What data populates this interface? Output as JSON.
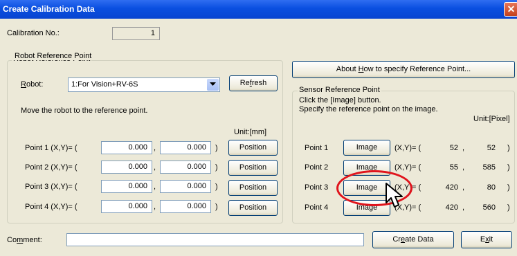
{
  "window": {
    "title": "Create Calibration Data",
    "close_glyph": "✕"
  },
  "calibration": {
    "label": "Calibration No.:",
    "value": "1"
  },
  "robot_ref": {
    "group_title": "Robot Reference Point",
    "robot_label_u": "R",
    "robot_label_rest": "obot:",
    "robot_value": "1:For Vision+RV-6S",
    "refresh_pre": "Re",
    "refresh_u": "f",
    "refresh_post": "resh",
    "instruction": "Move the robot to the reference point.",
    "unit": "Unit:[mm]",
    "points": [
      {
        "label": "Point 1 (X,Y)= (",
        "x": "0.000",
        "y": "0.000",
        "button": "Position"
      },
      {
        "label": "Point 2 (X,Y)= (",
        "x": "0.000",
        "y": "0.000",
        "button": "Position"
      },
      {
        "label": "Point 3 (X,Y)= (",
        "x": "0.000",
        "y": "0.000",
        "button": "Position"
      },
      {
        "label": "Point 4 (X,Y)= (",
        "x": "0.000",
        "y": "0.000",
        "button": "Position"
      }
    ],
    "comma": ",",
    "close_paren": ")"
  },
  "about_button": {
    "pre": "About ",
    "u": "H",
    "post": "ow to specify Reference Point..."
  },
  "sensor_ref": {
    "group_title": "Sensor Reference Point",
    "instruction1": "Click the [Image] button.",
    "instruction2": "Specify the reference point on the image.",
    "unit": "Unit:[Pixel]",
    "points": [
      {
        "label": "Point 1",
        "button": "Image",
        "coord_label": "(X,Y)= (",
        "x": "52",
        "y": "52"
      },
      {
        "label": "Point 2",
        "button": "Image",
        "coord_label": "(X,Y)= (",
        "x": "55",
        "y": "585"
      },
      {
        "label": "Point 3",
        "button": "Image",
        "coord_label": "(X,Y)= (",
        "x": "420",
        "y": "80"
      },
      {
        "label": "Point 4",
        "button": "Image",
        "coord_label": "(X,Y)= (",
        "x": "420",
        "y": "560"
      }
    ],
    "sep": ",",
    "close_paren": ")"
  },
  "comment": {
    "label_pre": "Co",
    "label_u": "m",
    "label_post": "ment:",
    "value": ""
  },
  "create_button": {
    "pre": "Cr",
    "u": "e",
    "post": "ate Data"
  },
  "exit_button": {
    "pre": "E",
    "u": "x",
    "post": "it"
  },
  "icons": {
    "dropdown": "chevron-down-icon",
    "cursor": "mouse-pointer-icon"
  },
  "colors": {
    "highlight_circle": "#e0141c",
    "title_bar": "#0a4fe0"
  }
}
